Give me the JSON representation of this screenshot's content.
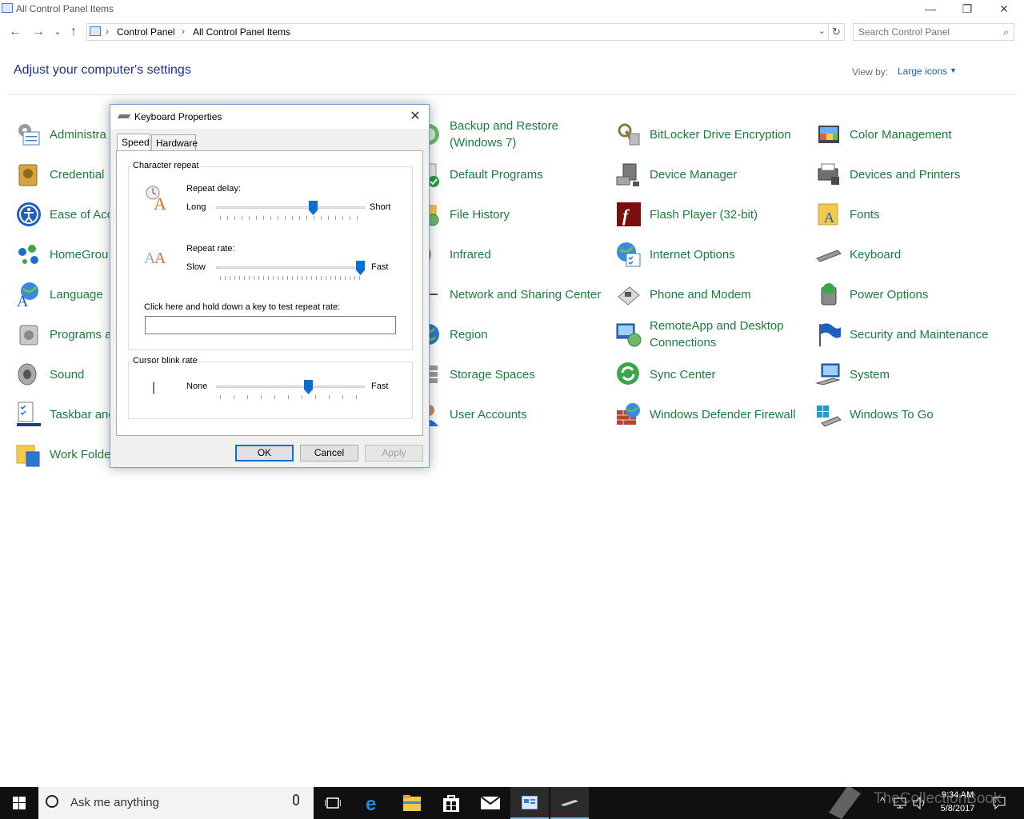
{
  "window": {
    "title": "All Control Panel Items",
    "minimize": "—",
    "restore": "❐",
    "close": "✕"
  },
  "nav": {
    "back": "←",
    "forward": "→",
    "recent": "⌄",
    "up": "↑",
    "breadcrumb": [
      "Control Panel",
      "All Control Panel Items"
    ],
    "separator": "›",
    "refresh": "↻",
    "dropdown": "⌄"
  },
  "search": {
    "placeholder": "Search Control Panel",
    "icon": "⌕"
  },
  "header": {
    "title": "Adjust your computer's settings",
    "view_by_label": "View by:",
    "view_by_value": "Large icons",
    "caret": "▼"
  },
  "items": {
    "col1": [
      "Administra",
      "Credential",
      "Ease of Acc",
      "HomeGrou",
      "Language",
      "Programs a",
      "Sound",
      "Taskbar anc",
      "Work Folde"
    ],
    "col3": [
      "Backup and Restore (Windows 7)",
      "Default Programs",
      "File History",
      "Infrared",
      "Network and Sharing Center",
      "Region",
      "Storage Spaces",
      "User Accounts"
    ],
    "col4": [
      "BitLocker Drive Encryption",
      "Device Manager",
      "Flash Player (32-bit)",
      "Internet Options",
      "Phone and Modem",
      "RemoteApp and Desktop Connections",
      "Sync Center",
      "Windows Defender Firewall"
    ],
    "col5": [
      "Color Management",
      "Devices and Printers",
      "Fonts",
      "Keyboard",
      "Power Options",
      "Security and Maintenance",
      "System",
      "Windows To Go"
    ]
  },
  "dialog": {
    "title": "Keyboard Properties",
    "close": "✕",
    "tabs": [
      "Speed",
      "Hardware"
    ],
    "char_repeat": {
      "group_title": "Character repeat",
      "delay_label": "Repeat delay:",
      "delay_min": "Long",
      "delay_max": "Short",
      "delay_value": 0.66,
      "rate_label": "Repeat rate:",
      "rate_min": "Slow",
      "rate_max": "Fast",
      "rate_value": 1.0,
      "test_label": "Click here and hold down a key to test repeat rate:",
      "test_value": ""
    },
    "cursor": {
      "group_title": "Cursor blink rate",
      "min": "None",
      "max": "Fast",
      "value": 0.63,
      "cursor_glyph": "|"
    },
    "buttons": {
      "ok": "OK",
      "cancel": "Cancel",
      "apply": "Apply"
    }
  },
  "taskbar": {
    "search_text": "Ask me anything",
    "clock_time": "9:34 AM",
    "clock_date": "5/8/2017",
    "watermark": "TheCollectionBook"
  },
  "colors": {
    "link_green": "#1a7d3b",
    "heading_blue": "#1e3287",
    "accent_blue": "#0a6fd4"
  }
}
